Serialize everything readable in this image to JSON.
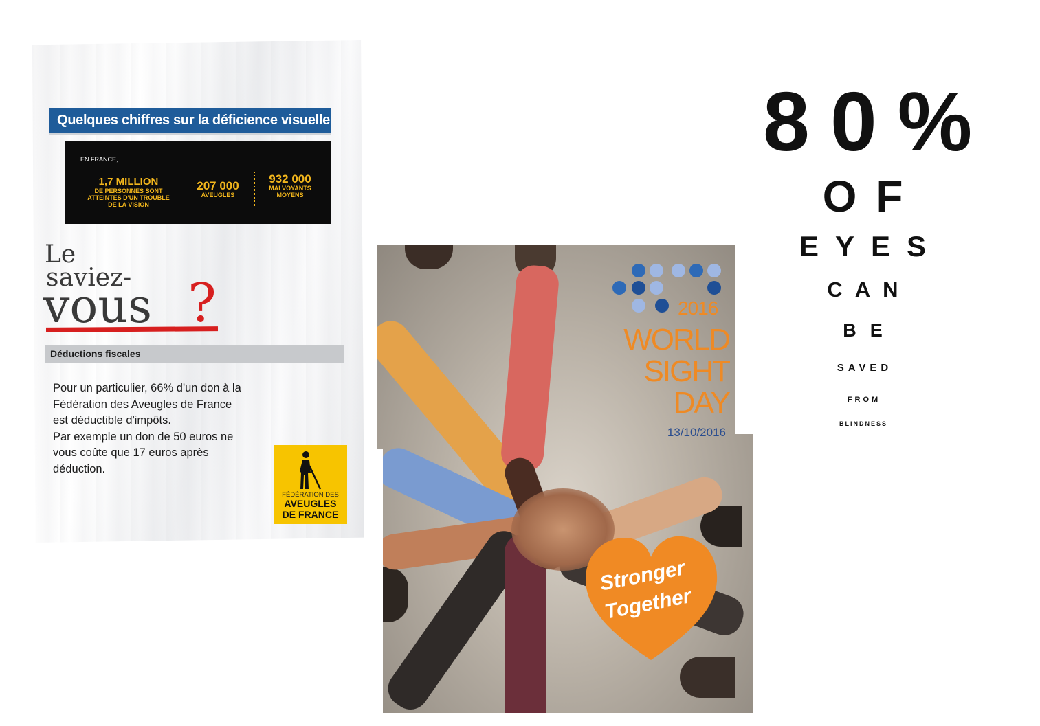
{
  "flyer": {
    "header_title": "Quelques chiffres sur la déficience visuelle",
    "stats_intro": "EN FRANCE,",
    "stats": [
      {
        "number": "1,7 MILLION",
        "label_lines": [
          "DE PERSONNES SONT",
          "ATTEINTES D'UN TROUBLE",
          "DE LA VISION"
        ]
      },
      {
        "number": "207 000",
        "label_lines": [
          "AVEUGLES"
        ]
      },
      {
        "number": "932 000",
        "label_lines": [
          "MALVOYANTS",
          "MOYENS"
        ]
      }
    ],
    "headline_line1": "Le",
    "headline_line2": "saviez-",
    "headline_line3": "vous",
    "headline_mark": "?",
    "section_title": "Déductions fiscales",
    "body_lines": [
      "Pour un particulier, 66% d'un don à la",
      "Fédération des Aveugles de France",
      "est déductible d'impôts.",
      "Par exemple un don de 50 euros ne",
      "vous coûte que 17 euros après",
      "déduction."
    ],
    "logo_line1": "FÉDÉRATION DES",
    "logo_line2": "AVEUGLES",
    "logo_line3": "DE FRANCE",
    "logo_color": "#f7c400",
    "header_color": "#1f5c9a"
  },
  "sight_day": {
    "year": "2016",
    "title_line1": "WORLD",
    "title_line2": "SIGHT",
    "title_line3": "DAY",
    "date": "13/10/2016",
    "heart_line1": "Stronger",
    "heart_line2": "Together",
    "accent_color": "#ee8a25",
    "date_color": "#2a4d8f"
  },
  "eye_chart": {
    "lines": [
      "80%",
      "OF",
      "EYES",
      "CAN",
      "BE",
      "SAVED",
      "FROM",
      "BLINDNESS"
    ]
  }
}
